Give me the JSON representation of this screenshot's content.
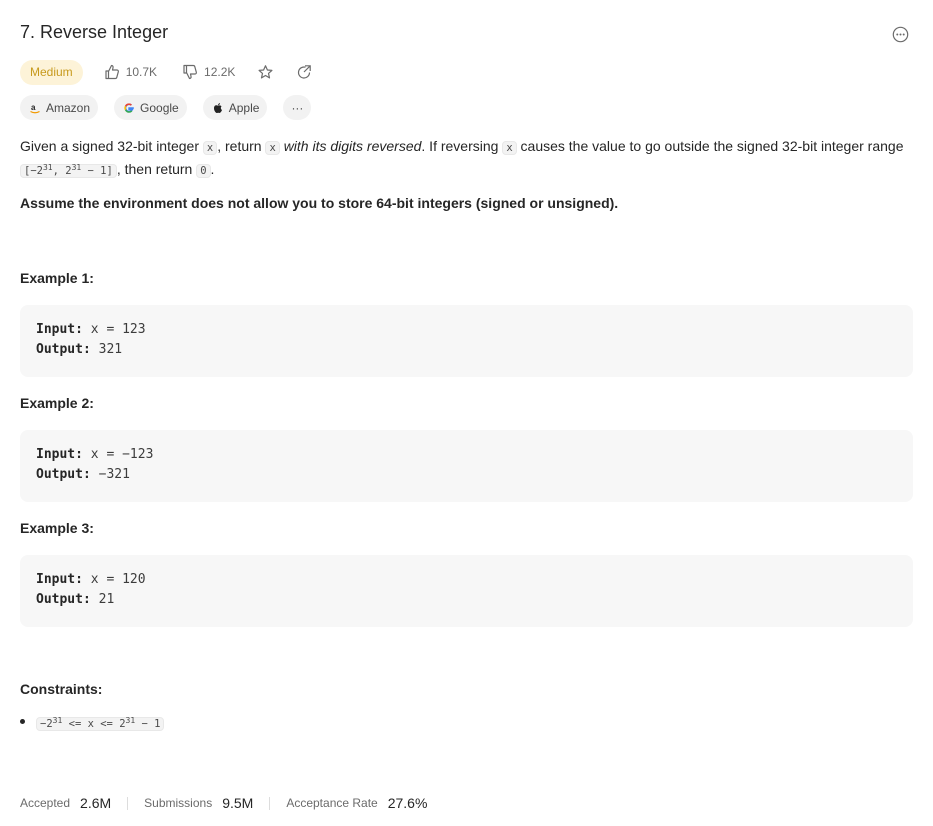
{
  "problem": {
    "title": "7. Reverse Integer",
    "difficulty": "Medium",
    "likes": "10.7K",
    "dislikes": "12.2K"
  },
  "companies": [
    {
      "name": "Amazon",
      "icon": "amazon-icon"
    },
    {
      "name": "Google",
      "icon": "google-icon"
    },
    {
      "name": "Apple",
      "icon": "apple-icon"
    }
  ],
  "more_companies": "···",
  "description": {
    "p1_a": "Given a signed 32-bit integer ",
    "code_x": "x",
    "p1_b": ", return ",
    "p1_em": "with its digits reversed",
    "p1_c": ". If reversing ",
    "p1_d": " causes the value to go outside the signed 32-bit integer range ",
    "range_a": "[−2",
    "range_exp1": "31",
    "range_b": ", 2",
    "range_exp2": "31",
    "range_c": " − 1]",
    "p1_e": ", then return ",
    "code_zero": "0",
    "p1_f": ".",
    "note": "Assume the environment does not allow you to store 64-bit integers (signed or unsigned)."
  },
  "examples": [
    {
      "title": "Example 1:",
      "input_label": "Input:",
      "input": "x = 123",
      "output_label": "Output:",
      "output": "321"
    },
    {
      "title": "Example 2:",
      "input_label": "Input:",
      "input": "x = −123",
      "output_label": "Output:",
      "output": "−321"
    },
    {
      "title": "Example 3:",
      "input_label": "Input:",
      "input": "x = 120",
      "output_label": "Output:",
      "output": "21"
    }
  ],
  "constraints": {
    "title": "Constraints:",
    "c1_a": "−2",
    "c1_exp1": "31",
    "c1_b": " <= x <= 2",
    "c1_exp2": "31",
    "c1_c": " − 1"
  },
  "stats": {
    "accepted_label": "Accepted",
    "accepted": "2.6M",
    "submissions_label": "Submissions",
    "submissions": "9.5M",
    "rate_label": "Acceptance Rate",
    "rate": "27.6%"
  },
  "colors": {
    "medium_bg": "#fdf3d8",
    "medium_text": "#c79a1d",
    "example_bg": "#f7f7f7"
  }
}
